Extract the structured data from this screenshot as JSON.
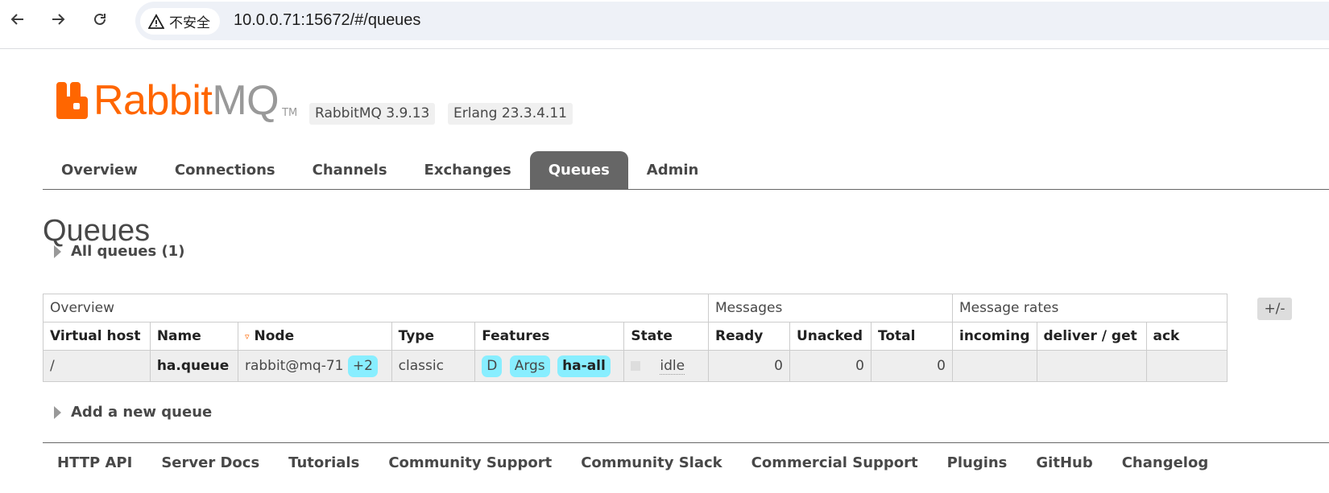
{
  "browser": {
    "security_label": "不安全",
    "url": "10.0.0.71:15672/#/queues"
  },
  "header": {
    "logo_rabbit": "Rabbit",
    "logo_mq": "MQ",
    "logo_tm": "TM",
    "rabbitmq_version": "RabbitMQ 3.9.13",
    "erlang_version": "Erlang 23.3.4.11"
  },
  "tabs": [
    {
      "label": "Overview"
    },
    {
      "label": "Connections"
    },
    {
      "label": "Channels"
    },
    {
      "label": "Exchanges"
    },
    {
      "label": "Queues",
      "active": true
    },
    {
      "label": "Admin"
    }
  ],
  "page": {
    "title": "Queues",
    "all_queues_label": "All queues (1)",
    "add_queue_label": "Add a new queue",
    "plus_minus": "+/-"
  },
  "table": {
    "groups": {
      "overview": "Overview",
      "messages": "Messages",
      "message_rates": "Message rates"
    },
    "columns": {
      "vhost": "Virtual host",
      "name": "Name",
      "node": "Node",
      "type": "Type",
      "features": "Features",
      "state": "State",
      "ready": "Ready",
      "unacked": "Unacked",
      "total": "Total",
      "incoming": "incoming",
      "deliver_get": "deliver / get",
      "ack": "ack"
    },
    "sort_indicator": "▿",
    "rows": [
      {
        "vhost": "/",
        "name": "ha.queue",
        "node": "rabbit@mq-71",
        "node_mirrors": "+2",
        "type": "classic",
        "feature_d": "D",
        "feature_args": "Args",
        "feature_policy": "ha-all",
        "state": "idle",
        "ready": "0",
        "unacked": "0",
        "total": "0",
        "incoming": "",
        "deliver_get": "",
        "ack": ""
      }
    ]
  },
  "footer": {
    "links": [
      "HTTP API",
      "Server Docs",
      "Tutorials",
      "Community Support",
      "Community Slack",
      "Commercial Support",
      "Plugins",
      "GitHub",
      "Changelog"
    ]
  },
  "colors": {
    "brand_orange": "#ff6600",
    "active_tab": "#666666",
    "feature_pill": "#88eeff"
  }
}
